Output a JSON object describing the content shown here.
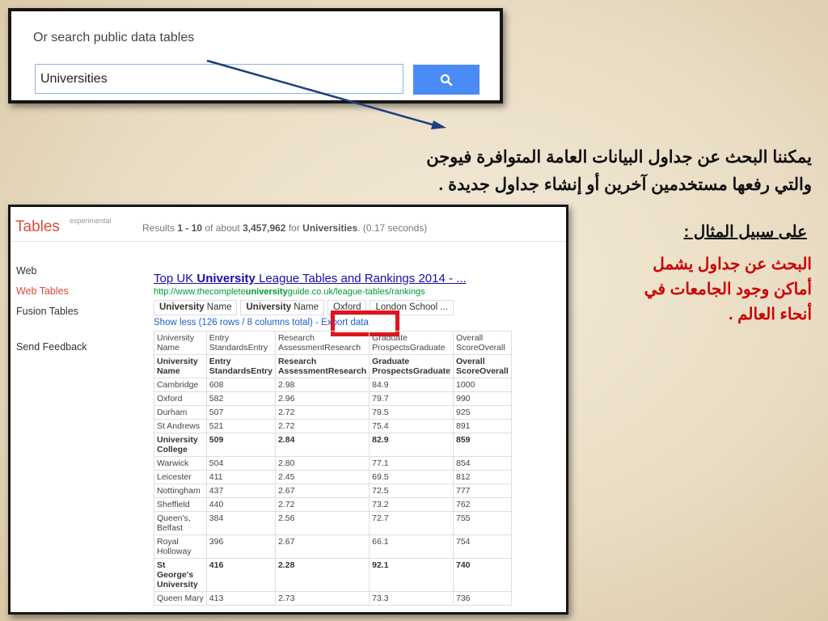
{
  "search_box": {
    "label": "Or search public data tables",
    "query": "Universities"
  },
  "arabic": {
    "line1": "يمكننا البحث عن جداول البيانات العامة المتوافرة فيوجن",
    "line2": "والتي رفعها مستخدمين آخرين أو إنشاء جداول جديدة .",
    "example_heading": "على سبيل المثال :",
    "example_l1": "البحث عن جداول يشمل",
    "example_l2": "أماكن وجود الجامعات في",
    "example_l3": "أنحاء العالم ."
  },
  "tables_panel": {
    "title": "Tables",
    "badge": "experimental",
    "results": {
      "prefix": "Results ",
      "range": "1 - 10",
      "mid": " of about ",
      "count": "3,457,962",
      "for": " for ",
      "term": "Universities",
      "time": ". (0.17 seconds)"
    },
    "nav": {
      "web": "Web",
      "web_tables": "Web Tables",
      "fusion_tables": "Fusion Tables",
      "feedback": "Send Feedback"
    },
    "result": {
      "title_a": "Top UK ",
      "title_b": "University",
      "title_c": " League Tables and Rankings 2014 - ...",
      "url_a": "http://www.thecomplete",
      "url_b": "university",
      "url_c": "guide.co.uk/league-tables/rankings",
      "tab1_b": "University",
      "tab1": " Name",
      "tab2_b": "University",
      "tab2": " Name",
      "tab3": "Oxford",
      "tab4": "London School ...",
      "show_less": "Show less (126 rows / 8 columns total)",
      "export": "- Export data"
    },
    "table": {
      "header1": [
        [
          "University",
          "Name"
        ],
        [
          "Entry",
          "StandardsEntry"
        ],
        [
          "Research",
          "AssessmentResearch"
        ],
        [
          "Graduate",
          "ProspectsGraduate"
        ],
        [
          "Overall",
          "ScoreOverall"
        ]
      ],
      "header2": [
        [
          "University",
          "Name"
        ],
        [
          "Entry",
          "StandardsEntry"
        ],
        [
          "Research",
          "AssessmentResearch"
        ],
        [
          "Graduate",
          "ProspectsGraduate"
        ],
        [
          "Overall",
          "ScoreOverall"
        ]
      ],
      "rows": [
        {
          "c": [
            [
              "Cambridge"
            ],
            [
              "608"
            ],
            [
              "2.98"
            ],
            [
              "84.9"
            ],
            [
              "1000"
            ]
          ]
        },
        {
          "c": [
            [
              "Oxford"
            ],
            [
              "582"
            ],
            [
              "2.96"
            ],
            [
              "79.7"
            ],
            [
              "990"
            ]
          ]
        },
        {
          "c": [
            [
              "Durham"
            ],
            [
              "507"
            ],
            [
              "2.72"
            ],
            [
              "79.5"
            ],
            [
              "925"
            ]
          ]
        },
        {
          "c": [
            [
              "St Andrews"
            ],
            [
              "521"
            ],
            [
              "2.72"
            ],
            [
              "75.4"
            ],
            [
              "891"
            ]
          ]
        },
        {
          "c": [
            [
              "University",
              "College"
            ],
            [
              "509"
            ],
            [
              "2.84"
            ],
            [
              "82.9"
            ],
            [
              "859"
            ]
          ],
          "bold": true
        },
        {
          "c": [
            [
              "Warwick"
            ],
            [
              "504"
            ],
            [
              "2.80"
            ],
            [
              "77.1"
            ],
            [
              "854"
            ]
          ]
        },
        {
          "c": [
            [
              "Leicester"
            ],
            [
              "411"
            ],
            [
              "2.45"
            ],
            [
              "69.5"
            ],
            [
              "812"
            ]
          ]
        },
        {
          "c": [
            [
              "Nottingham"
            ],
            [
              "437"
            ],
            [
              "2.67"
            ],
            [
              "72.5"
            ],
            [
              "777"
            ]
          ]
        },
        {
          "c": [
            [
              "Sheffield"
            ],
            [
              "440"
            ],
            [
              "2.72"
            ],
            [
              "73.2"
            ],
            [
              "762"
            ]
          ]
        },
        {
          "c": [
            [
              "Queen's,",
              "Belfast"
            ],
            [
              "384"
            ],
            [
              "2.56"
            ],
            [
              "72.7"
            ],
            [
              "755"
            ]
          ]
        },
        {
          "c": [
            [
              "Royal",
              "Holloway"
            ],
            [
              "396"
            ],
            [
              "2.67"
            ],
            [
              "66.1"
            ],
            [
              "754"
            ]
          ]
        },
        {
          "c": [
            [
              "St",
              "George's",
              "University"
            ],
            [
              "416"
            ],
            [
              "2.28"
            ],
            [
              "92.1"
            ],
            [
              "740"
            ]
          ],
          "bold": true
        },
        {
          "c": [
            [
              "Queen Mary"
            ],
            [
              "413"
            ],
            [
              "2.73"
            ],
            [
              "73.3"
            ],
            [
              "736"
            ]
          ]
        }
      ]
    }
  },
  "colors": {
    "search_button": "#4b8bf5",
    "tables_title": "#dd4b39",
    "link": "#1a0dab",
    "url": "#009933",
    "export_highlight": "#e0141e",
    "example_text": "#cc0000"
  },
  "icons": {
    "search_button": "magnifier-icon"
  }
}
